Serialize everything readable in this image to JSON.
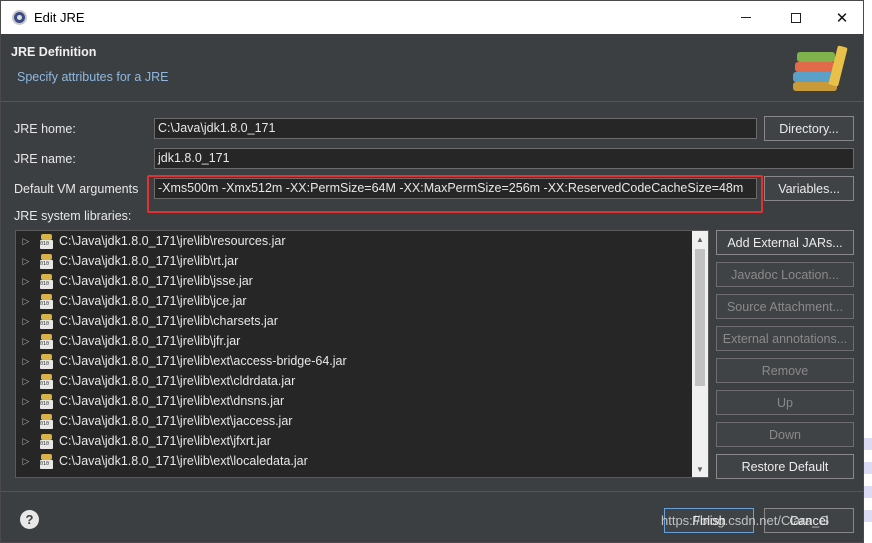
{
  "window": {
    "title": "Edit JRE",
    "controls": {
      "minimize": "—",
      "maximize": "□",
      "close": "✕"
    }
  },
  "header": {
    "title": "JRE Definition",
    "subtitle": "Specify attributes for a JRE",
    "icon": "library-books-icon"
  },
  "form": {
    "jre_home": {
      "label": "JRE home:",
      "value": "C:\\Java\\jdk1.8.0_171",
      "button": "Directory..."
    },
    "jre_name": {
      "label": "JRE name:",
      "value": "jdk1.8.0_171"
    },
    "vm_args": {
      "label": "Default VM arguments",
      "value": "-Xms500m -Xmx512m -XX:PermSize=64M -XX:MaxPermSize=256m -XX:ReservedCodeCacheSize=48m",
      "button": "Variables..."
    },
    "libraries_label": "JRE system libraries:"
  },
  "libraries": [
    "C:\\Java\\jdk1.8.0_171\\jre\\lib\\resources.jar",
    "C:\\Java\\jdk1.8.0_171\\jre\\lib\\rt.jar",
    "C:\\Java\\jdk1.8.0_171\\jre\\lib\\jsse.jar",
    "C:\\Java\\jdk1.8.0_171\\jre\\lib\\jce.jar",
    "C:\\Java\\jdk1.8.0_171\\jre\\lib\\charsets.jar",
    "C:\\Java\\jdk1.8.0_171\\jre\\lib\\jfr.jar",
    "C:\\Java\\jdk1.8.0_171\\jre\\lib\\ext\\access-bridge-64.jar",
    "C:\\Java\\jdk1.8.0_171\\jre\\lib\\ext\\cldrdata.jar",
    "C:\\Java\\jdk1.8.0_171\\jre\\lib\\ext\\dnsns.jar",
    "C:\\Java\\jdk1.8.0_171\\jre\\lib\\ext\\jaccess.jar",
    "C:\\Java\\jdk1.8.0_171\\jre\\lib\\ext\\jfxrt.jar",
    "C:\\Java\\jdk1.8.0_171\\jre\\lib\\ext\\localedata.jar"
  ],
  "side_buttons": {
    "add_external": "Add External JARs...",
    "javadoc": "Javadoc Location...",
    "source": "Source Attachment...",
    "annotations": "External annotations...",
    "remove": "Remove",
    "up": "Up",
    "down": "Down",
    "restore": "Restore Default"
  },
  "footer": {
    "help": "?",
    "finish": "Finish",
    "cancel": "Cancel",
    "watermark": "https://blog.csdn.net/Clara_G"
  },
  "colors": {
    "dialog_bg": "#3c3f41",
    "field_bg": "#262626",
    "subtitle": "#8fb8e0",
    "highlight": "#e03232"
  }
}
